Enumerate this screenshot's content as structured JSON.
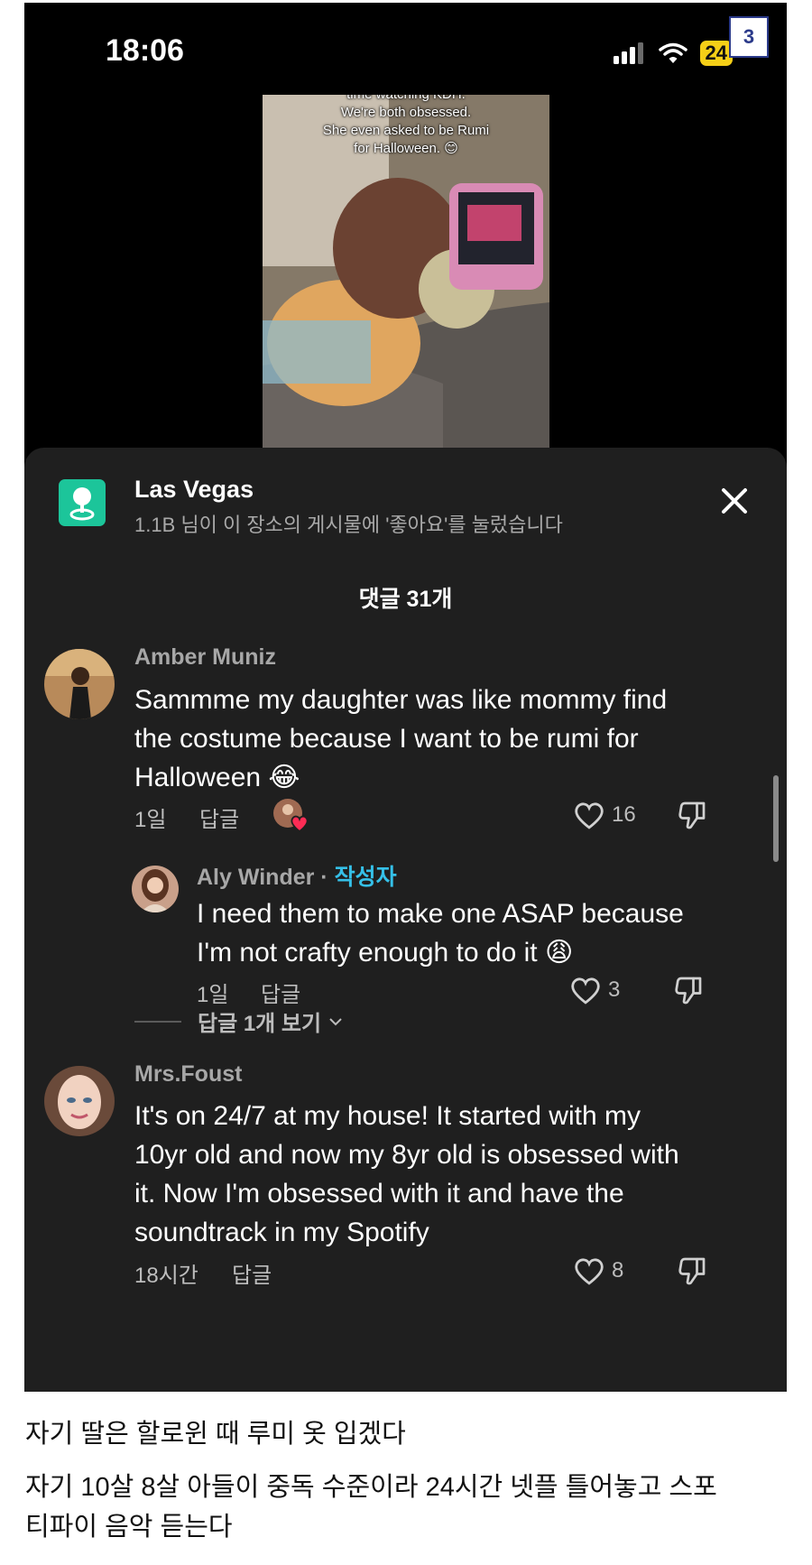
{
  "status_bar": {
    "time": "18:06",
    "battery": "24"
  },
  "page_badge": "3",
  "video": {
    "caption_lines": [
      "time watching KDH.",
      "We're both obsessed.",
      "She even asked to be Rumi",
      "for Halloween. 😊"
    ]
  },
  "location": {
    "title": "Las Vegas",
    "subtitle": "1.1B 님이 이 장소의 게시물에 '좋아요'를 눌렀습니다",
    "icon": "location-pin-icon",
    "icon_color": "#1cc59a"
  },
  "comments_header": "댓글 31개",
  "comments": [
    {
      "username": "Amber Muniz",
      "text_lines": [
        "Sammme my daughter was like mommy find",
        "the costume because I want to be rumi for",
        "Halloween 😂"
      ],
      "age": "1일",
      "reply_label": "답글",
      "likes": "16"
    },
    {
      "username": "Aly Winder",
      "author_sep": " · ",
      "author_tag": "작성자",
      "text_lines": [
        "I need them to make one ASAP because",
        "I'm not crafty enough to do it 😩"
      ],
      "age": "1일",
      "reply_label": "답글",
      "likes": "3"
    },
    {
      "username": "Mrs.Foust",
      "text_lines": [
        "It's on 24/7 at my house! It started with my",
        "10yr old and now my 8yr old is obsessed with",
        "it. Now I'm obsessed with it and have the",
        "soundtrack in my Spotify"
      ],
      "age": "18시간",
      "reply_label": "답글",
      "likes": "8"
    }
  ],
  "view_replies": "답글 1개 보기",
  "colors": {
    "panel_bg": "#1f1f1f",
    "author_tag": "#35c0e8",
    "battery": "#f5cf17"
  },
  "post_caption": {
    "line1": "자기 딸은 할로윈 때 루미 옷 입겠다",
    "line2": "자기 10살 8살 아들이 중독 수준이라 24시간 넷플 틀어놓고 스포",
    "line3": "티파이 음악 듣는다"
  }
}
